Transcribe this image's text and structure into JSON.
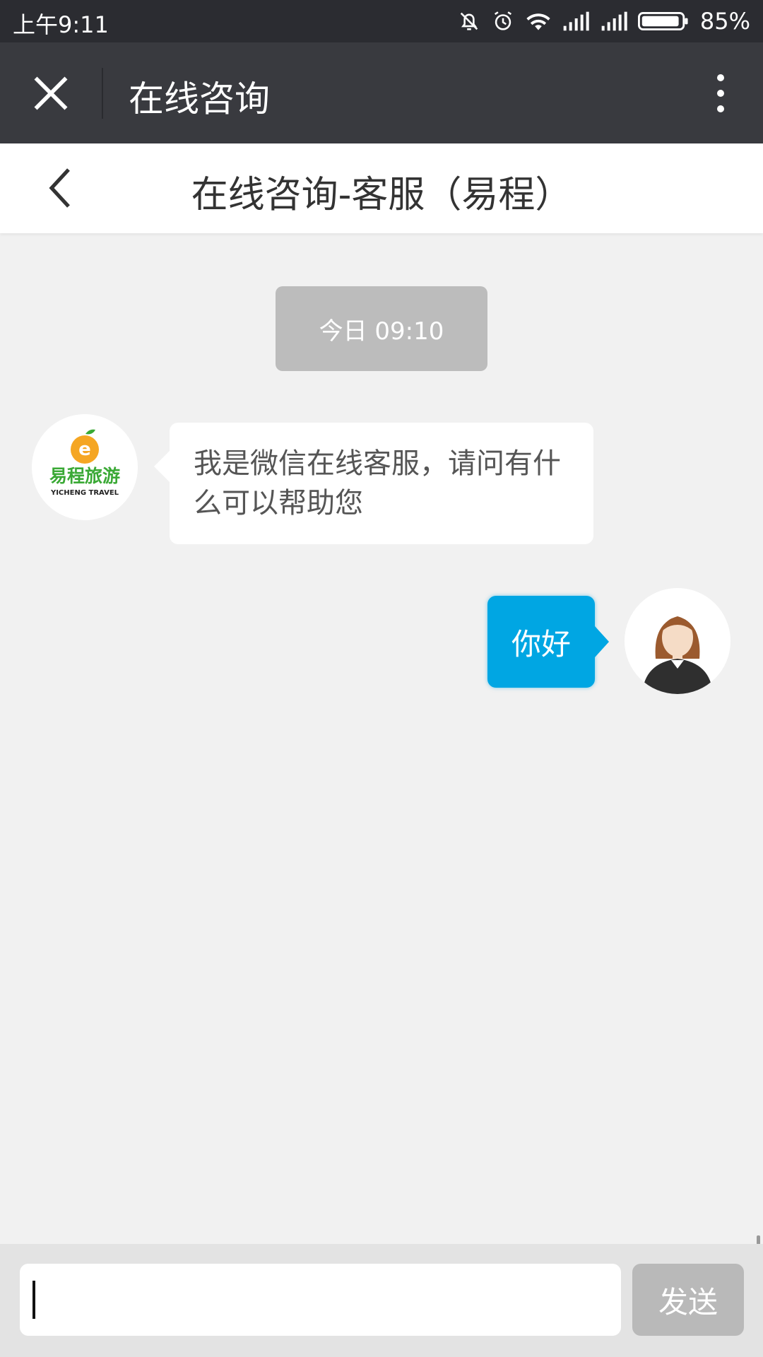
{
  "status_bar": {
    "time": "上午9:11",
    "battery": "85%",
    "icons": [
      "mute-bell-icon",
      "alarm-icon",
      "wifi-icon",
      "signal-icon",
      "signal-icon",
      "battery-icon"
    ]
  },
  "wechat_bar": {
    "title": "在线咨询",
    "close_icon": "close-icon",
    "more_icon": "more-vertical-icon"
  },
  "page_header": {
    "title": "在线咨询-客服（易程）",
    "back_icon": "chevron-left-icon"
  },
  "chat": {
    "timestamp": "今日 09:10",
    "messages": [
      {
        "from": "service",
        "avatar_brand": "易程旅游",
        "avatar_brand_en": "YICHENG TRAVEL",
        "text": "我是微信在线客服，请问有什么可以帮助您"
      },
      {
        "from": "user",
        "text": "你好"
      }
    ]
  },
  "composer": {
    "value": "",
    "send_label": "发送"
  },
  "colors": {
    "status_bar_bg": "#2b2c31",
    "wechat_bar_bg": "#393a3f",
    "chat_bg": "#f1f1f1",
    "user_bubble": "#00a6e3",
    "send_button": "#b9b9b9",
    "brand_green": "#3aa935",
    "brand_orange": "#f5a623"
  }
}
